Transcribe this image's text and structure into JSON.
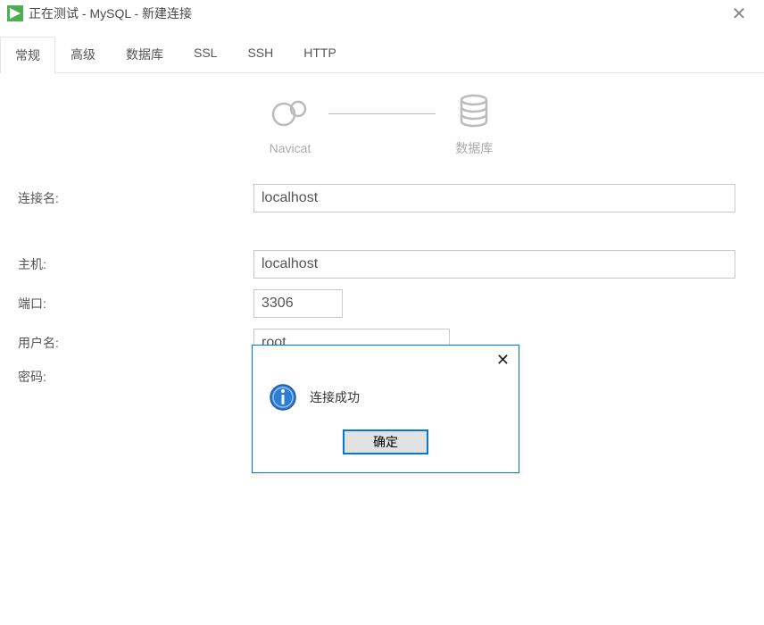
{
  "window": {
    "title": "正在测试 - MySQL - 新建连接"
  },
  "tabs": [
    {
      "label": "常规"
    },
    {
      "label": "高级"
    },
    {
      "label": "数据库"
    },
    {
      "label": "SSL"
    },
    {
      "label": "SSH"
    },
    {
      "label": "HTTP"
    }
  ],
  "diagram": {
    "left_label": "Navicat",
    "right_label": "数据库"
  },
  "form": {
    "connection_name_label": "连接名:",
    "connection_name_value": "localhost",
    "host_label": "主机:",
    "host_value": "localhost",
    "port_label": "端口:",
    "port_value": "3306",
    "username_label": "用户名:",
    "username_value": "root",
    "password_label": "密码:"
  },
  "dialog": {
    "message": "连接成功",
    "ok_label": "确定"
  }
}
